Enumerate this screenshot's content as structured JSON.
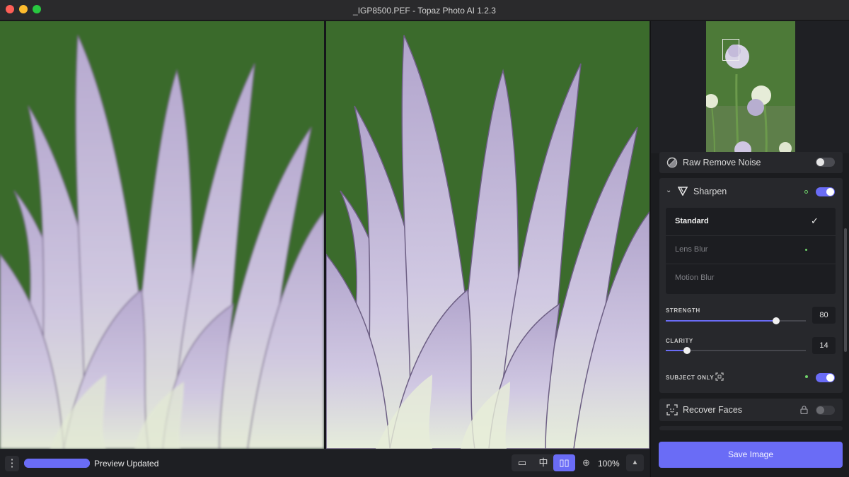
{
  "window": {
    "title": "_IGP8500.PEF - Topaz Photo AI 1.2.3"
  },
  "bottombar": {
    "menu_glyph": "⋮",
    "progress_fraction": 1.0,
    "status": "Preview Updated",
    "view_single_glyph": "▭",
    "view_split_glyph": "中",
    "view_side_glyph": "▯▯",
    "zoom_glyph": "⊕",
    "zoom": "100%",
    "expand_glyph": "▲"
  },
  "sidebar": {
    "raw_noise": {
      "label": "Raw Remove Noise",
      "enabled": false
    },
    "sharpen": {
      "label": "Sharpen",
      "enabled": true,
      "modes": [
        {
          "label": "Standard",
          "selected": true
        },
        {
          "label": "Lens Blur",
          "selected": false
        },
        {
          "label": "Motion Blur",
          "selected": false
        }
      ],
      "check_glyph": "✓",
      "strength": {
        "label": "STRENGTH",
        "value": "80"
      },
      "clarity": {
        "label": "CLARITY",
        "value": "14"
      },
      "subject_only": {
        "label": "SUBJECT ONLY",
        "enabled": true
      }
    },
    "recover_faces": {
      "label": "Recover Faces",
      "enabled": false
    },
    "save_label": "Save Image"
  },
  "colors": {
    "accent": "#6a6cf6",
    "dot_green": "#6fd36a",
    "background_green": "#3b6b2c",
    "petal": "#c9c0de"
  }
}
